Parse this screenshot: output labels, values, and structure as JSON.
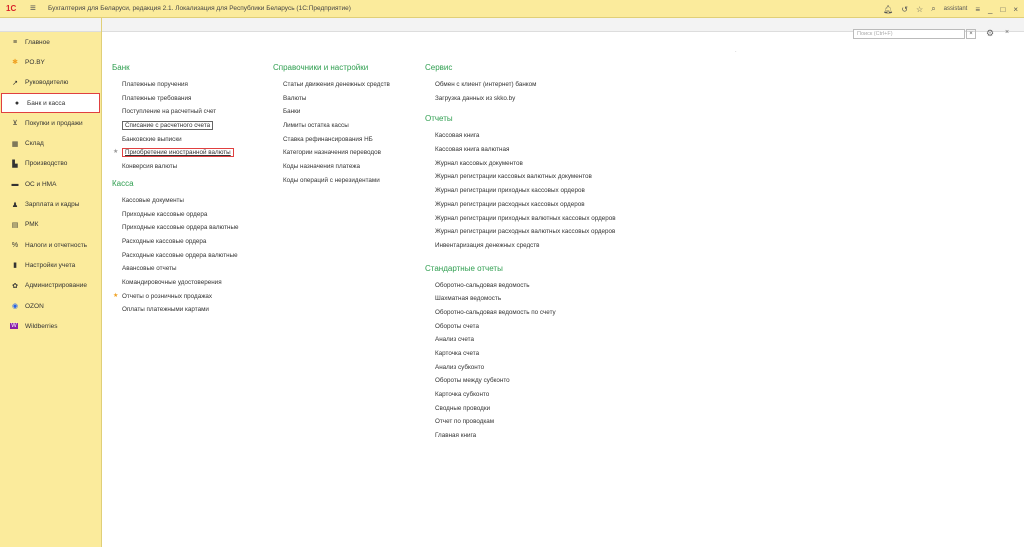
{
  "titlebar": {
    "logo": "1С",
    "title": "Бухгалтерия для Беларуси, редакция 2.1. Локализация для Республики Беларусь  (1С:Предприятие)",
    "user": "assistant"
  },
  "search": {
    "placeholder": "Поиск (Ctrl+F)"
  },
  "sidebar": {
    "items": [
      {
        "label": "Главное",
        "icon": "menu-icon"
      },
      {
        "label": "PO.BY",
        "icon": "sparkle-icon"
      },
      {
        "label": "Руководителю",
        "icon": "trend-icon"
      },
      {
        "label": "Банк и касса",
        "icon": "bank-icon"
      },
      {
        "label": "Покупки и продажи",
        "icon": "cart-icon"
      },
      {
        "label": "Склад",
        "icon": "warehouse-icon"
      },
      {
        "label": "Производство",
        "icon": "factory-icon"
      },
      {
        "label": "ОС и НМА",
        "icon": "truck-icon"
      },
      {
        "label": "Зарплата и кадры",
        "icon": "person-icon"
      },
      {
        "label": "РМК",
        "icon": "register-icon"
      },
      {
        "label": "Налоги и отчетность",
        "icon": "percent-icon"
      },
      {
        "label": "Настройки учета",
        "icon": "book-icon"
      },
      {
        "label": "Администрирование",
        "icon": "gear-icon"
      },
      {
        "label": "OZON",
        "icon": "ozon-icon"
      },
      {
        "label": "Wildberries",
        "icon": "wildberries-icon"
      }
    ]
  },
  "bank": {
    "title": "Банк",
    "links": [
      "Платежные поручения",
      "Платежные требования",
      "Поступление на расчетный счет",
      "Списание с расчетного счета",
      "Банковские выписки",
      "Приобретение иностранной валюты",
      "Конверсия валюты"
    ]
  },
  "kassa": {
    "title": "Касса",
    "links": [
      "Кассовые документы",
      "Приходные кассовые ордера",
      "Приходные кассовые ордера валютные",
      "Расходные кассовые ордера",
      "Расходные кассовые ордера валютные",
      "Авансовые отчеты",
      "Командировочные удостоверения",
      "Отчеты о розничных продажах",
      "Оплаты платежными картами"
    ]
  },
  "spravochniki": {
    "title": "Справочники и настройки",
    "links": [
      "Статьи движения денежных средств",
      "Валюты",
      "Банки",
      "Лимиты остатка кассы",
      "Ставка рефинансирования НБ",
      "Категории назначения переводов",
      "Коды назначения платежа",
      "Коды операций с нерезидентами"
    ]
  },
  "servis": {
    "title": "Сервис",
    "links": [
      "Обмен с клиент (интернет) банком",
      "Загрузка данных из skko.by"
    ]
  },
  "otchety": {
    "title": "Отчеты",
    "links": [
      "Кассовая книга",
      "Кассовая книга валютная",
      "Журнал кассовых документов",
      "Журнал регистрации кассовых валютных документов",
      "Журнал регистрации приходных кассовых ордеров",
      "Журнал регистрации расходных кассовых ордеров",
      "Журнал регистрации приходных валютных кассовых ордеров",
      "Журнал регистрации расходных валютных кассовых ордеров",
      "Инвентаризация денежных средств"
    ]
  },
  "standard": {
    "title": "Стандартные отчеты",
    "links": [
      "Оборотно-сальдовая ведомость",
      "Шахматная ведомость",
      "Оборотно-сальдовая ведомость по счету",
      "Обороты счета",
      "Анализ счета",
      "Карточка счета",
      "Анализ субконто",
      "Обороты между субконто",
      "Карточка субконто",
      "Сводные проводки",
      "Отчет по проводкам",
      "Главная книга"
    ]
  },
  "colors": {
    "accent_green": "#2e9e4f",
    "sidebar_bg": "#fbeb9c",
    "highlight_red": "#e04040",
    "star": "#f0a020"
  }
}
